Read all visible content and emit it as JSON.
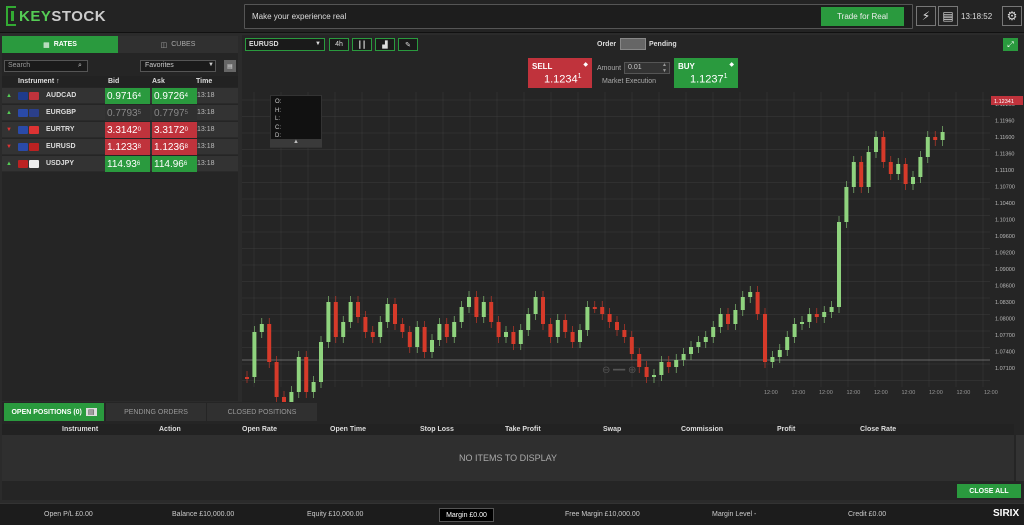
{
  "header": {
    "logo_main": "STOCK",
    "logo_prefix": "KEY",
    "promo_text": "Make your experience real",
    "trade_real_label": "Trade for Real",
    "clock": "13:18:52"
  },
  "rates_panel": {
    "tab_rates": "RATES",
    "tab_cubes": "CUBES",
    "search_placeholder": "Search",
    "favorites": "Favorites",
    "col_instrument": "Instrument ↑",
    "col_bid": "Bid",
    "col_ask": "Ask",
    "col_time": "Time",
    "rows": [
      {
        "symbol": "AUDCAD",
        "dir": "up",
        "bid": "0.9716",
        "bid_sup": "4",
        "ask": "0.9726",
        "ask_sup": "4",
        "bid_state": "up",
        "ask_state": "up",
        "time": "13:18",
        "flag1": "#1f3b8c",
        "flag2": "#c0333c"
      },
      {
        "symbol": "EURGBP",
        "dir": "up",
        "bid": "0.7793",
        "bid_sup": "5",
        "ask": "0.7797",
        "ask_sup": "5",
        "bid_state": "neu",
        "ask_state": "neu",
        "time": "13:18",
        "flag1": "#2a4aa8",
        "flag2": "#2b3f8a"
      },
      {
        "symbol": "EURTRY",
        "dir": "down",
        "bid": "3.3142",
        "bid_sup": "0",
        "ask": "3.3172",
        "ask_sup": "0",
        "bid_state": "dn",
        "ask_state": "dn",
        "time": "13:18",
        "flag1": "#2a4aa8",
        "flag2": "#d33"
      },
      {
        "symbol": "EURUSD",
        "dir": "down",
        "bid": "1.1233",
        "bid_sup": "8",
        "ask": "1.1236",
        "ask_sup": "8",
        "bid_state": "dn",
        "ask_state": "dn",
        "time": "13:18",
        "flag1": "#2a4aa8",
        "flag2": "#b22"
      },
      {
        "symbol": "USDJPY",
        "dir": "up",
        "bid": "114.93",
        "bid_sup": "6",
        "ask": "114.96",
        "ask_sup": "6",
        "bid_state": "up",
        "ask_state": "up",
        "time": "13:18",
        "flag1": "#b22",
        "flag2": "#eee"
      }
    ]
  },
  "chart_panel": {
    "symbol": "EURUSD",
    "timeframe": "4h",
    "order_label": "Order",
    "pending_label": "Pending",
    "sell_label": "SELL",
    "sell_price": "1.1234",
    "sell_sup": "1",
    "buy_label": "BUY",
    "buy_price": "1.1237",
    "buy_sup": "1",
    "amount_label": "Amount",
    "amount_value": "0.01",
    "market_execution": "Market Execution",
    "ohlc_labels": [
      "O:",
      "H:",
      "L:",
      "C:",
      "D:"
    ],
    "current_price_tag": "1.12341",
    "price_ticks": [
      "1.12200",
      "1.11960",
      "1.11600",
      "1.11360",
      "1.11100",
      "1.10700",
      "1.10400",
      "1.10100",
      "1.09600",
      "1.09200",
      "1.09000",
      "1.08600",
      "1.08300",
      "1.08000",
      "1.07700",
      "1.07400",
      "1.07100"
    ],
    "time_labels": [
      "12:00",
      "12:00",
      "12:00",
      "12:00",
      "12:00",
      "12:00",
      "12:00",
      "12:00",
      "12:00"
    ],
    "colors": {
      "up": "#8fd37e",
      "down": "#d63a2a"
    }
  },
  "positions": {
    "tab_open": "OPEN POSITIONS (0)",
    "tab_pending": "PENDING ORDERS",
    "tab_closed": "CLOSED POSITIONS",
    "columns": [
      "Instrument",
      "Action",
      "Open Rate",
      "Open Time",
      "Stop Loss",
      "Take Profit",
      "Swap",
      "Commission",
      "Profit",
      "Close Rate"
    ],
    "empty_text": "NO ITEMS TO DISPLAY",
    "close_all": "CLOSE ALL"
  },
  "footer": {
    "open_pl": "Open P/L £0.00",
    "balance": "Balance £10,000.00",
    "equity": "Equity £10,000.00",
    "margin": "Margin £0.00",
    "free_margin": "Free Margin £10,000.00",
    "margin_level": "Margin Level -",
    "credit": "Credit £0.00",
    "brand": "SIRIX"
  }
}
